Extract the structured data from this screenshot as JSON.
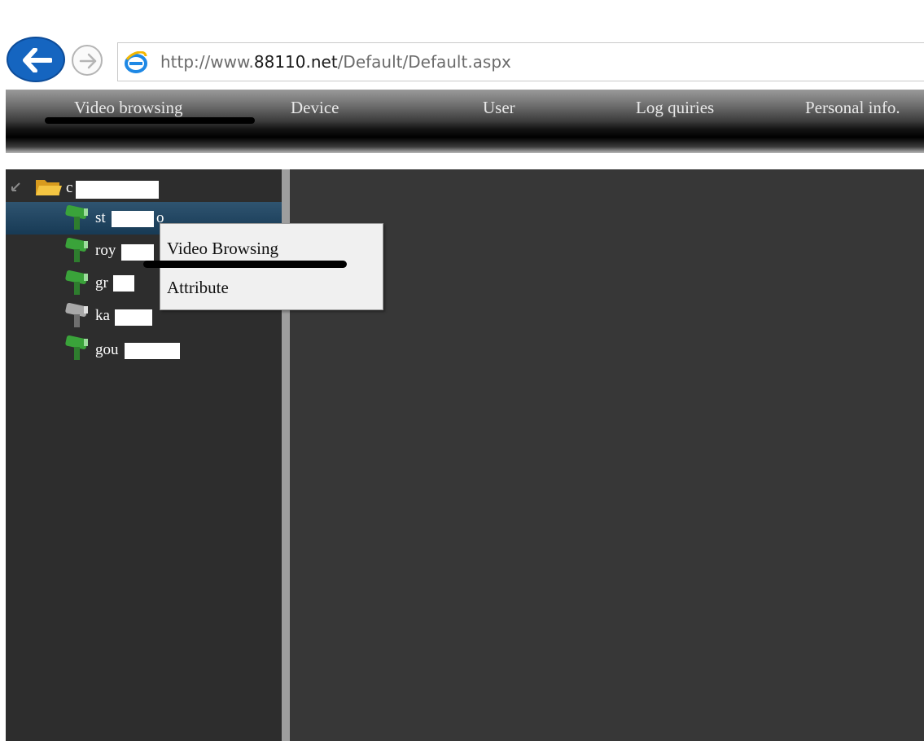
{
  "browser": {
    "url_prefix": "http://www.",
    "url_host": "88110.net",
    "url_path": "/Default/Default.aspx"
  },
  "nav": {
    "items": [
      "Video browsing",
      "Device",
      "User",
      "Log quiries",
      "Personal info."
    ]
  },
  "tree": {
    "root_label": "c",
    "nodes": [
      {
        "prefix": "st",
        "suffix": "o",
        "status": "online"
      },
      {
        "prefix": "roy",
        "suffix": "",
        "status": "online"
      },
      {
        "prefix": "gr",
        "suffix": "",
        "status": "online"
      },
      {
        "prefix": "ka",
        "suffix": "",
        "status": "offline"
      },
      {
        "prefix": "gou",
        "suffix": "",
        "status": "online"
      }
    ]
  },
  "context_menu": {
    "items": [
      "Video Browsing",
      "Attribute"
    ]
  },
  "colors": {
    "online_camera": "#3aa33a",
    "offline_camera": "#9a9a9a",
    "selection": "#1f4663",
    "back_button": "#1565c0"
  }
}
